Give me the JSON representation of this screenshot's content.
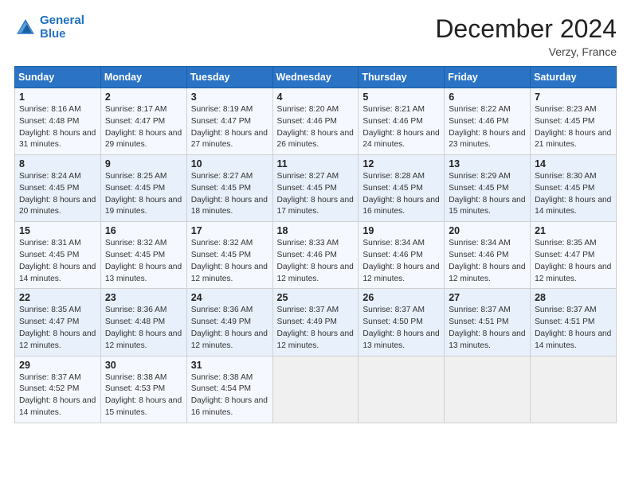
{
  "header": {
    "logo_line1": "General",
    "logo_line2": "Blue",
    "month": "December 2024",
    "location": "Verzy, France"
  },
  "days_of_week": [
    "Sunday",
    "Monday",
    "Tuesday",
    "Wednesday",
    "Thursday",
    "Friday",
    "Saturday"
  ],
  "weeks": [
    [
      {
        "num": "1",
        "sr": "Sunrise: 8:16 AM",
        "ss": "Sunset: 4:48 PM",
        "dl": "Daylight: 8 hours and 31 minutes."
      },
      {
        "num": "2",
        "sr": "Sunrise: 8:17 AM",
        "ss": "Sunset: 4:47 PM",
        "dl": "Daylight: 8 hours and 29 minutes."
      },
      {
        "num": "3",
        "sr": "Sunrise: 8:19 AM",
        "ss": "Sunset: 4:47 PM",
        "dl": "Daylight: 8 hours and 27 minutes."
      },
      {
        "num": "4",
        "sr": "Sunrise: 8:20 AM",
        "ss": "Sunset: 4:46 PM",
        "dl": "Daylight: 8 hours and 26 minutes."
      },
      {
        "num": "5",
        "sr": "Sunrise: 8:21 AM",
        "ss": "Sunset: 4:46 PM",
        "dl": "Daylight: 8 hours and 24 minutes."
      },
      {
        "num": "6",
        "sr": "Sunrise: 8:22 AM",
        "ss": "Sunset: 4:46 PM",
        "dl": "Daylight: 8 hours and 23 minutes."
      },
      {
        "num": "7",
        "sr": "Sunrise: 8:23 AM",
        "ss": "Sunset: 4:45 PM",
        "dl": "Daylight: 8 hours and 21 minutes."
      }
    ],
    [
      {
        "num": "8",
        "sr": "Sunrise: 8:24 AM",
        "ss": "Sunset: 4:45 PM",
        "dl": "Daylight: 8 hours and 20 minutes."
      },
      {
        "num": "9",
        "sr": "Sunrise: 8:25 AM",
        "ss": "Sunset: 4:45 PM",
        "dl": "Daylight: 8 hours and 19 minutes."
      },
      {
        "num": "10",
        "sr": "Sunrise: 8:27 AM",
        "ss": "Sunset: 4:45 PM",
        "dl": "Daylight: 8 hours and 18 minutes."
      },
      {
        "num": "11",
        "sr": "Sunrise: 8:27 AM",
        "ss": "Sunset: 4:45 PM",
        "dl": "Daylight: 8 hours and 17 minutes."
      },
      {
        "num": "12",
        "sr": "Sunrise: 8:28 AM",
        "ss": "Sunset: 4:45 PM",
        "dl": "Daylight: 8 hours and 16 minutes."
      },
      {
        "num": "13",
        "sr": "Sunrise: 8:29 AM",
        "ss": "Sunset: 4:45 PM",
        "dl": "Daylight: 8 hours and 15 minutes."
      },
      {
        "num": "14",
        "sr": "Sunrise: 8:30 AM",
        "ss": "Sunset: 4:45 PM",
        "dl": "Daylight: 8 hours and 14 minutes."
      }
    ],
    [
      {
        "num": "15",
        "sr": "Sunrise: 8:31 AM",
        "ss": "Sunset: 4:45 PM",
        "dl": "Daylight: 8 hours and 14 minutes."
      },
      {
        "num": "16",
        "sr": "Sunrise: 8:32 AM",
        "ss": "Sunset: 4:45 PM",
        "dl": "Daylight: 8 hours and 13 minutes."
      },
      {
        "num": "17",
        "sr": "Sunrise: 8:32 AM",
        "ss": "Sunset: 4:45 PM",
        "dl": "Daylight: 8 hours and 12 minutes."
      },
      {
        "num": "18",
        "sr": "Sunrise: 8:33 AM",
        "ss": "Sunset: 4:46 PM",
        "dl": "Daylight: 8 hours and 12 minutes."
      },
      {
        "num": "19",
        "sr": "Sunrise: 8:34 AM",
        "ss": "Sunset: 4:46 PM",
        "dl": "Daylight: 8 hours and 12 minutes."
      },
      {
        "num": "20",
        "sr": "Sunrise: 8:34 AM",
        "ss": "Sunset: 4:46 PM",
        "dl": "Daylight: 8 hours and 12 minutes."
      },
      {
        "num": "21",
        "sr": "Sunrise: 8:35 AM",
        "ss": "Sunset: 4:47 PM",
        "dl": "Daylight: 8 hours and 12 minutes."
      }
    ],
    [
      {
        "num": "22",
        "sr": "Sunrise: 8:35 AM",
        "ss": "Sunset: 4:47 PM",
        "dl": "Daylight: 8 hours and 12 minutes."
      },
      {
        "num": "23",
        "sr": "Sunrise: 8:36 AM",
        "ss": "Sunset: 4:48 PM",
        "dl": "Daylight: 8 hours and 12 minutes."
      },
      {
        "num": "24",
        "sr": "Sunrise: 8:36 AM",
        "ss": "Sunset: 4:49 PM",
        "dl": "Daylight: 8 hours and 12 minutes."
      },
      {
        "num": "25",
        "sr": "Sunrise: 8:37 AM",
        "ss": "Sunset: 4:49 PM",
        "dl": "Daylight: 8 hours and 12 minutes."
      },
      {
        "num": "26",
        "sr": "Sunrise: 8:37 AM",
        "ss": "Sunset: 4:50 PM",
        "dl": "Daylight: 8 hours and 13 minutes."
      },
      {
        "num": "27",
        "sr": "Sunrise: 8:37 AM",
        "ss": "Sunset: 4:51 PM",
        "dl": "Daylight: 8 hours and 13 minutes."
      },
      {
        "num": "28",
        "sr": "Sunrise: 8:37 AM",
        "ss": "Sunset: 4:51 PM",
        "dl": "Daylight: 8 hours and 14 minutes."
      }
    ],
    [
      {
        "num": "29",
        "sr": "Sunrise: 8:37 AM",
        "ss": "Sunset: 4:52 PM",
        "dl": "Daylight: 8 hours and 14 minutes."
      },
      {
        "num": "30",
        "sr": "Sunrise: 8:38 AM",
        "ss": "Sunset: 4:53 PM",
        "dl": "Daylight: 8 hours and 15 minutes."
      },
      {
        "num": "31",
        "sr": "Sunrise: 8:38 AM",
        "ss": "Sunset: 4:54 PM",
        "dl": "Daylight: 8 hours and 16 minutes."
      },
      null,
      null,
      null,
      null
    ]
  ]
}
